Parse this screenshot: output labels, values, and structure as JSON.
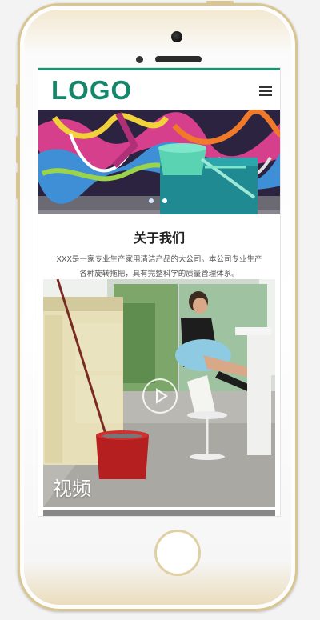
{
  "header": {
    "logo": "LOGO",
    "menu_icon": "hamburger-menu-icon",
    "accent_color": "#179470"
  },
  "banner": {
    "slides": 2,
    "active_slide": 1,
    "dot_icon": "carousel-dot"
  },
  "about": {
    "title": "关于我们",
    "text": "XXX是一家专业生产家用清洁产品的大公司。本公司专业生产各种旋转拖把，具有完整科学的质量管理体系。"
  },
  "video": {
    "label": "视频",
    "play_icon": "play-circle-icon"
  }
}
